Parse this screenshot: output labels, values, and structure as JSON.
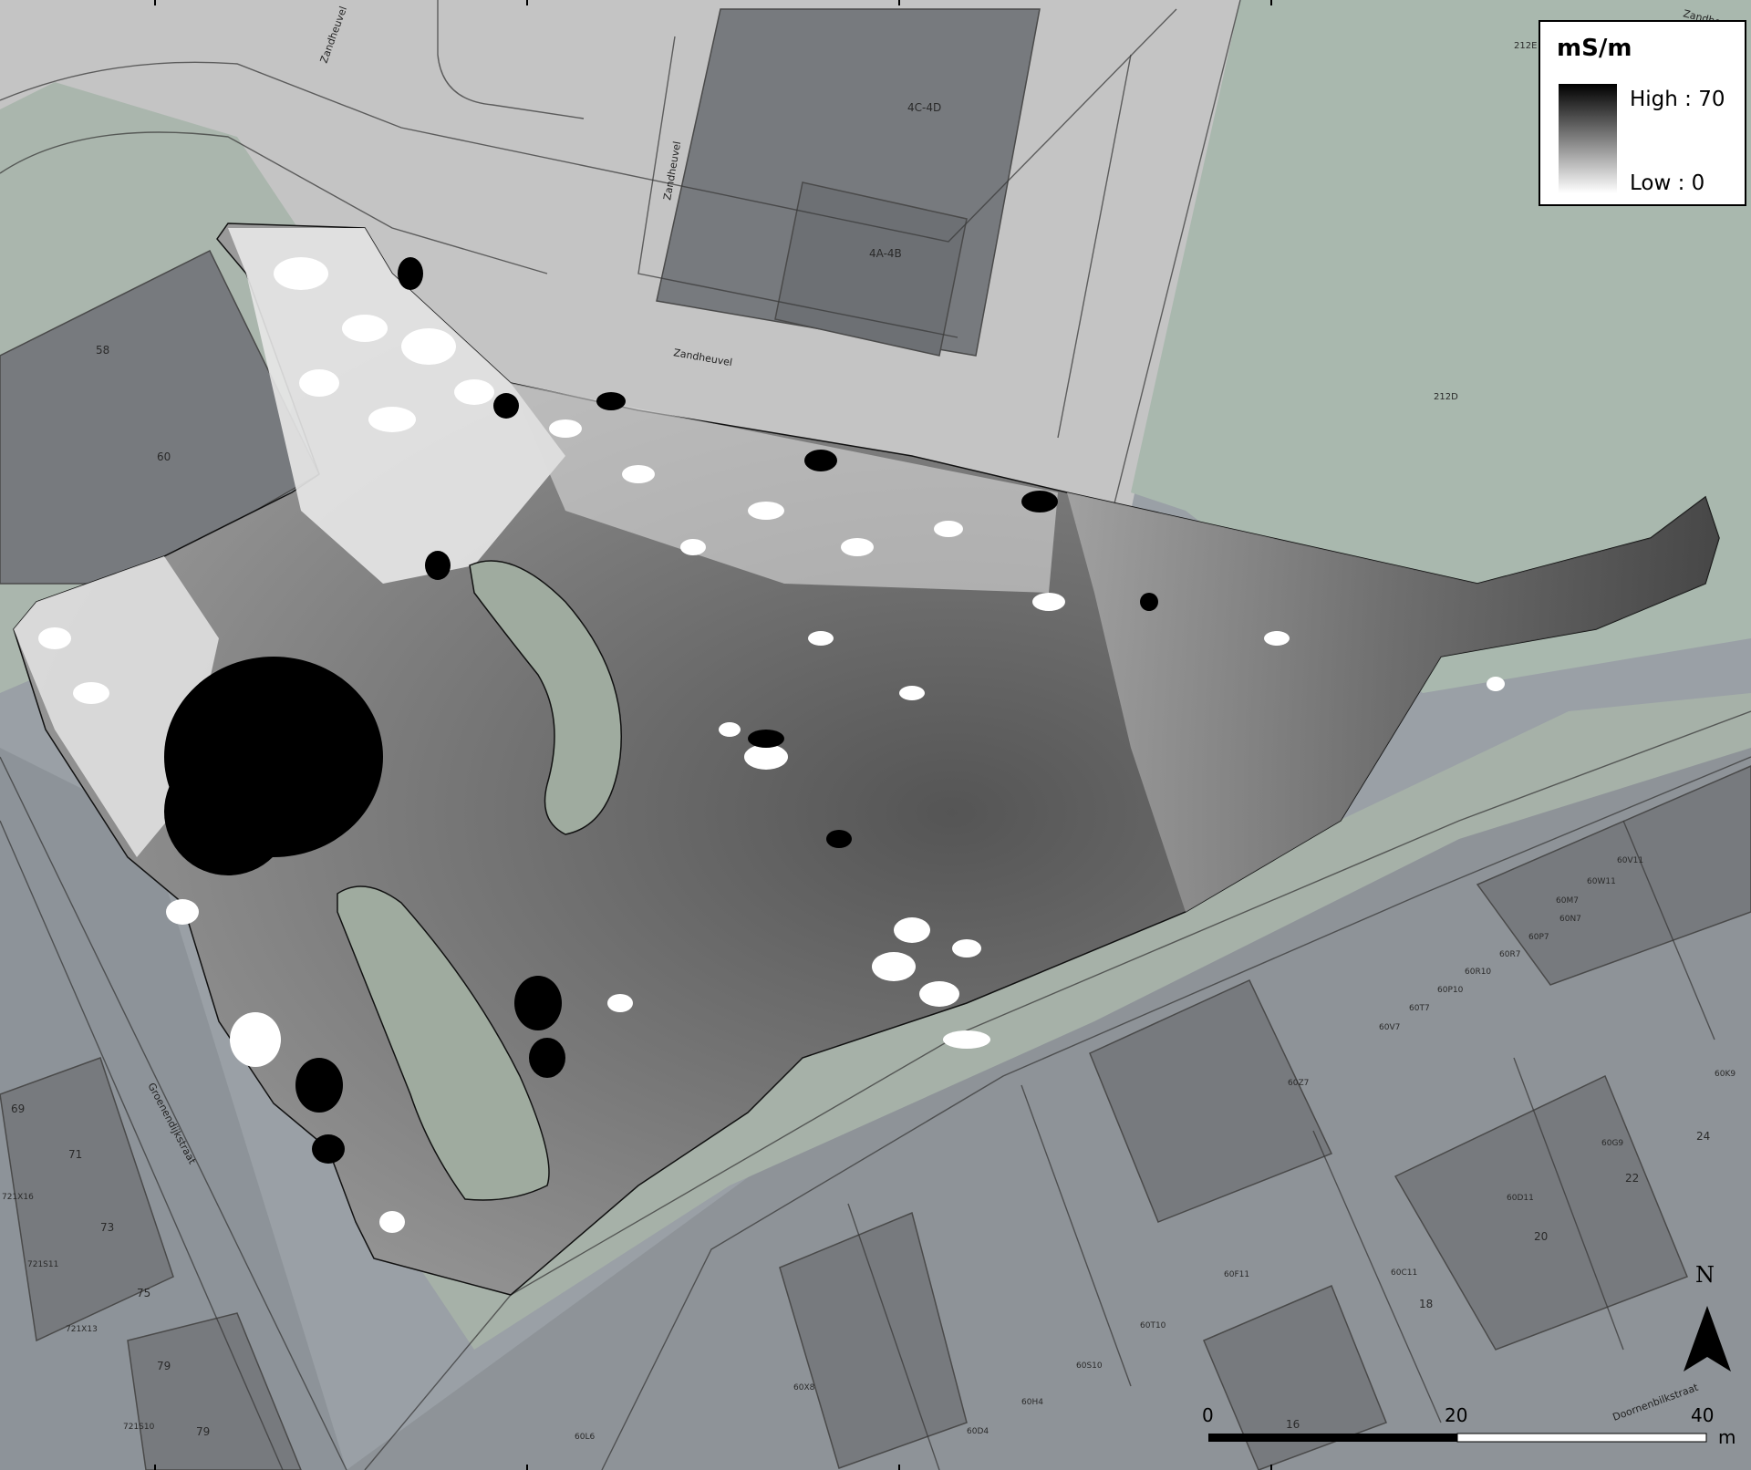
{
  "legend": {
    "unit": "mS/m",
    "high_label": "High : 70",
    "low_label": "Low : 0",
    "ramp_colors": [
      "#000000",
      "#ffffff"
    ]
  },
  "north_arrow": {
    "label": "N"
  },
  "scale_bar": {
    "ticks": [
      "0",
      "20",
      "40"
    ],
    "unit": "m"
  },
  "street_labels": [
    "Zandheuvel",
    "Zandheuvel",
    "Zandheuvel",
    "Zandheuvel",
    "Groenendijkstraat",
    "Doornenbilkstraat"
  ],
  "parcel_labels": [
    "58",
    "60",
    "4C-4D",
    "4A-4B",
    "212D",
    "212E",
    "69",
    "71",
    "73",
    "75",
    "79",
    "79",
    "721S11",
    "721X13",
    "721S10",
    "721X16",
    "60V11",
    "60W11",
    "60M7",
    "60N7",
    "60P7",
    "60R7",
    "60R10",
    "60P10",
    "60T7",
    "60V7",
    "60Z7",
    "60K9",
    "60G9",
    "60D11",
    "60C11",
    "60F11",
    "60T10",
    "60S10",
    "60X8",
    "60H4",
    "60D4",
    "60L6",
    "24",
    "22",
    "20",
    "18",
    "16"
  ],
  "colors": {
    "survey_high": "#000000",
    "survey_low": "#ffffff",
    "basemap_field": "#a7b4ac",
    "basemap_pavement": "#bcbcbc",
    "basemap_roof": "#7d7f83"
  }
}
